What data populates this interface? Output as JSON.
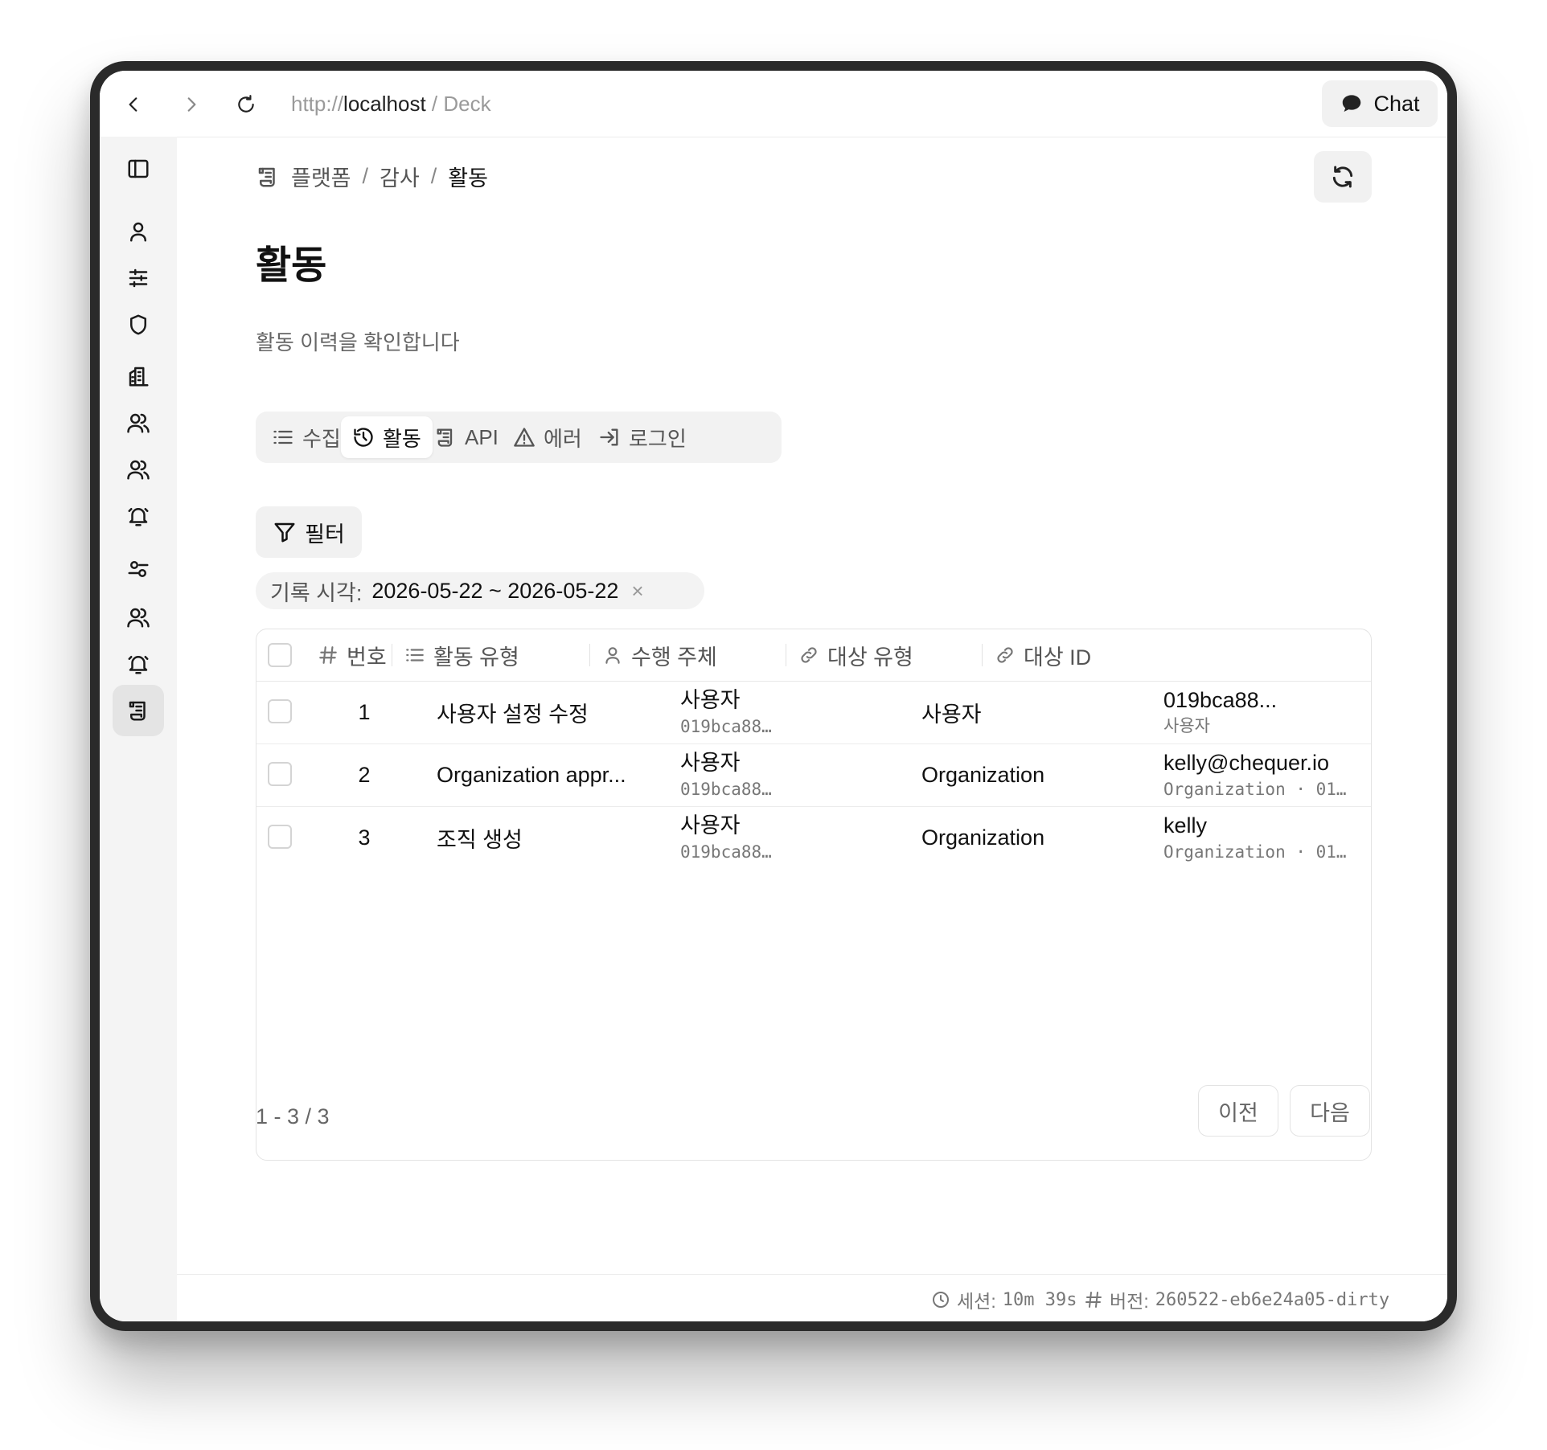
{
  "browser": {
    "url_scheme": "http://",
    "url_host": "localhost",
    "url_suffix": " / Deck",
    "chat_label": "Chat"
  },
  "sidebar": {
    "items": [
      {
        "icon": "sidebar-toggle-icon"
      },
      {
        "icon": "user-icon"
      },
      {
        "icon": "sliders-icon"
      },
      {
        "icon": "shield-icon"
      },
      {
        "icon": "building-icon"
      },
      {
        "icon": "users-icon"
      },
      {
        "icon": "users-icon"
      },
      {
        "icon": "bell-icon"
      },
      {
        "icon": "settings-toggle-icon"
      },
      {
        "icon": "users-icon"
      },
      {
        "icon": "bell-icon"
      },
      {
        "icon": "scroll-icon",
        "active": true
      }
    ]
  },
  "breadcrumb": {
    "items": [
      "플랫폼",
      "감사",
      "활동"
    ],
    "separator": "/"
  },
  "page": {
    "title": "활동",
    "subtitle": "활동 이력을 확인합니다"
  },
  "tabs": [
    {
      "label": "수집",
      "icon": "list-icon"
    },
    {
      "label": "활동",
      "icon": "history-icon",
      "active": true
    },
    {
      "label": "API",
      "icon": "scroll-icon"
    },
    {
      "label": "에러",
      "icon": "warning-icon"
    },
    {
      "label": "로그인",
      "icon": "login-icon"
    }
  ],
  "filter": {
    "button_label": "필터",
    "chip_label": "기록 시각:",
    "chip_value": "2026-05-22 ~ 2026-05-22",
    "chip_remove": "×"
  },
  "table": {
    "columns": [
      "번호",
      "활동 유형",
      "수행 주체",
      "대상 유형",
      "대상 ID"
    ],
    "rows": [
      {
        "num": "1",
        "activity_type": "사용자 설정 수정",
        "actor": "사용자",
        "actor_id": "019bca88…",
        "target_type": "사용자",
        "target_id": "019bca88...",
        "target_sub": "사용자"
      },
      {
        "num": "2",
        "activity_type": "Organization appr...",
        "actor": "사용자",
        "actor_id": "019bca88…",
        "target_type": "Organization",
        "target_id": "kelly@chequer.io",
        "target_sub": "Organization · 01…"
      },
      {
        "num": "3",
        "activity_type": "조직 생성",
        "actor": "사용자",
        "actor_id": "019bca88…",
        "target_type": "Organization",
        "target_id": "kelly",
        "target_sub": "Organization · 01…"
      }
    ]
  },
  "pagination": {
    "info": "1 - 3 / 3",
    "prev_label": "이전",
    "next_label": "다음"
  },
  "status": {
    "session_label": "세션:",
    "session_value": "10m 39s",
    "version_label": "버전:",
    "version_value": "260522-eb6e24a05-dirty"
  }
}
